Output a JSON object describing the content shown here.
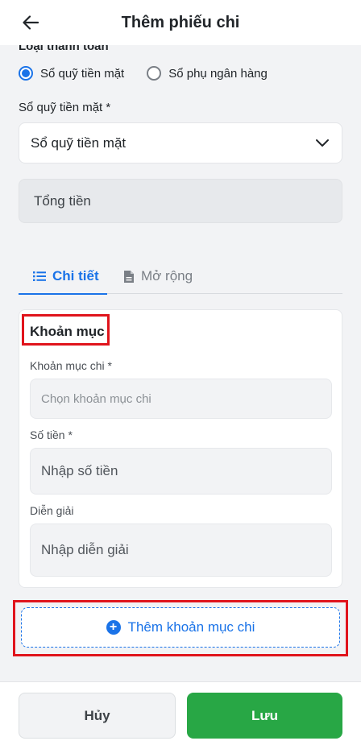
{
  "header": {
    "title": "Thêm phiếu chi"
  },
  "payment": {
    "label": "Loại thanh toán",
    "options": [
      {
        "label": "Sổ quỹ tiền mặt",
        "checked": true
      },
      {
        "label": "Sổ phụ ngân hàng",
        "checked": false
      }
    ]
  },
  "cash_book": {
    "label": "Sổ quỹ tiền mặt *",
    "value": "Sổ quỹ tiền mặt"
  },
  "total": {
    "placeholder": "Tổng tiền"
  },
  "tabs": [
    {
      "label": "Chi tiết",
      "icon": "list-icon",
      "active": true
    },
    {
      "label": "Mở rộng",
      "icon": "document-icon",
      "active": false
    }
  ],
  "item_card": {
    "title": "Khoản mục",
    "expense_label": "Khoản mục chi *",
    "expense_placeholder": "Chọn khoản mục chi",
    "amount_label": "Số tiền *",
    "amount_placeholder": "Nhập số tiền",
    "desc_label": "Diễn giải",
    "desc_placeholder": "Nhập diễn giải"
  },
  "add_item": {
    "label": "Thêm khoản mục chi",
    "icon": "plus-circle-icon"
  },
  "footer": {
    "cancel": "Hủy",
    "save": "Lưu"
  },
  "colors": {
    "primary": "#1a73e8",
    "success": "#28a745",
    "highlight": "#e0141c"
  }
}
